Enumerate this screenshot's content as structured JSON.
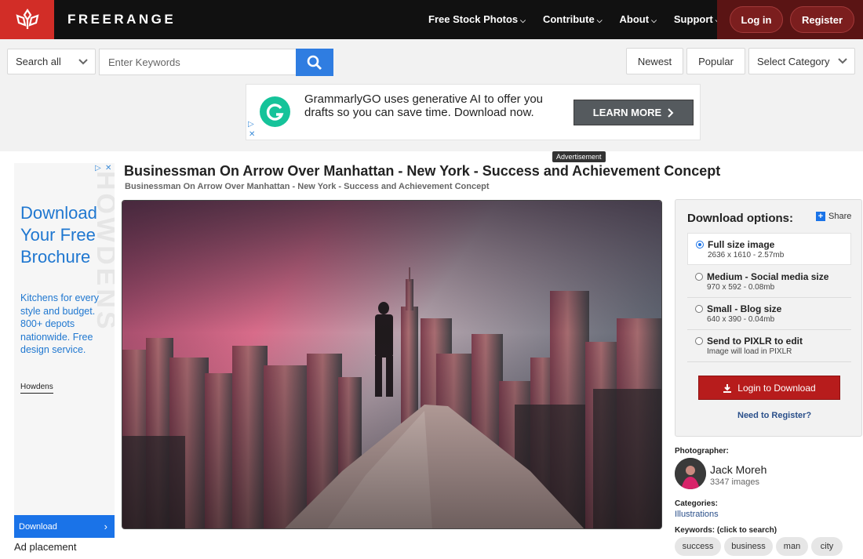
{
  "header": {
    "brand": "FREERANGE",
    "nav": [
      {
        "label": "Free Stock Photos"
      },
      {
        "label": "Contribute"
      },
      {
        "label": "About"
      },
      {
        "label": "Support"
      }
    ],
    "login_label": "Log in",
    "register_label": "Register",
    "colors": {
      "logo_bg": "#d22d27",
      "bar_bg": "#111111",
      "auth_bg": "#5a1414"
    }
  },
  "search": {
    "scope_value": "Search all",
    "placeholder": "Enter Keywords",
    "sort_newest": "Newest",
    "sort_popular": "Popular",
    "category_value": "Select Category"
  },
  "top_ad": {
    "text": "GrammarlyGO uses generative AI to offer you drafts so you can save time. Download now.",
    "cta": "LEARN MORE",
    "label": "Advertisement"
  },
  "left_ad": {
    "headline": "Download Your Free Brochure",
    "body": "Kitchens for every style and budget. 800+ depots nationwide. Free design service.",
    "brand": "Howdens",
    "cta": "Download",
    "watermark": "HOWDENS",
    "placement": "Ad placement"
  },
  "photo": {
    "title": "Businessman On Arrow Over Manhattan - New York - Success and Achievement Concept",
    "subtitle": "Businessman On Arrow Over Manhattan - New York - Success and Achievement Concept"
  },
  "download": {
    "title": "Download options:",
    "share": "Share",
    "options": [
      {
        "label": "Full size image",
        "sub": "2636 x 1610 - 2.57mb",
        "selected": true
      },
      {
        "label": "Medium - Social media size",
        "sub": "970 x 592 - 0.08mb",
        "selected": false
      },
      {
        "label": "Small - Blog size",
        "sub": "640 x 390 - 0.04mb",
        "selected": false
      },
      {
        "label": "Send to PIXLR to edit",
        "sub": "Image will load in PIXLR",
        "selected": false
      }
    ],
    "button": "Login to Download",
    "register_link": "Need to Register?"
  },
  "photographer": {
    "label": "Photographer:",
    "name": "Jack Moreh",
    "count": "3347 images"
  },
  "categories": {
    "label": "Categories:",
    "value": "Illustrations"
  },
  "keywords": {
    "label": "Keywords: (click to search)",
    "tags": [
      "success",
      "business",
      "man",
      "city"
    ]
  }
}
